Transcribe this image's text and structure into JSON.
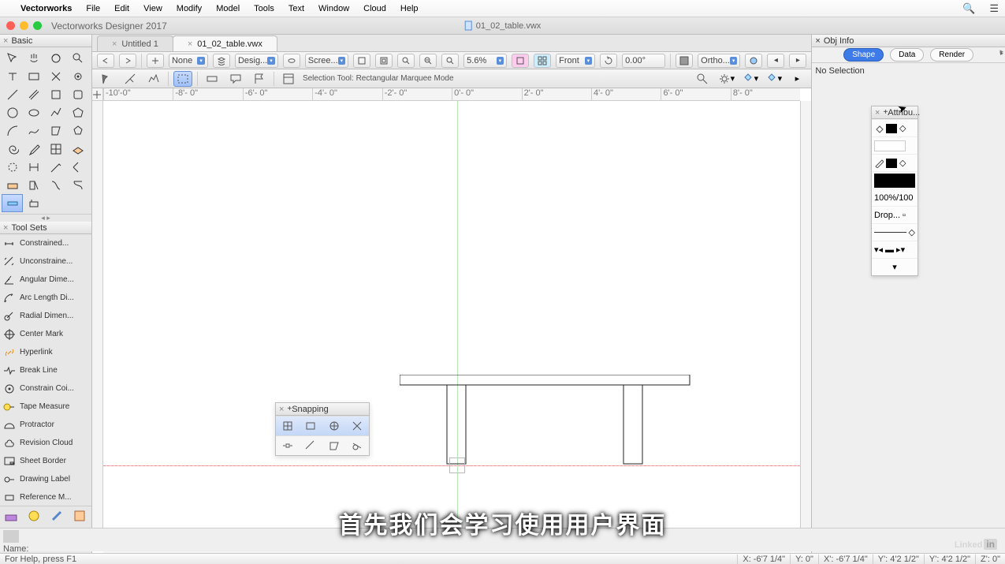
{
  "menubar": {
    "app": "Vectorworks",
    "items": [
      "File",
      "Edit",
      "View",
      "Modify",
      "Model",
      "Tools",
      "Text",
      "Window",
      "Cloud",
      "Help"
    ]
  },
  "titlebar": {
    "wintitle": "Vectorworks Designer 2017",
    "docfile": "01_02_table.vwx"
  },
  "doctabs": [
    {
      "label": "Untitled 1",
      "active": false
    },
    {
      "label": "01_02_table.vwx",
      "active": true
    }
  ],
  "basic": {
    "title": "Basic"
  },
  "toolsets": {
    "title": "Tool Sets",
    "items": [
      "Constrained...",
      "Unconstraine...",
      "Angular Dime...",
      "Arc Length Di...",
      "Radial Dimen...",
      "Center Mark",
      "Hyperlink",
      "Break Line",
      "Constrain Coi...",
      "Tape Measure",
      "Protractor",
      "Revision Cloud",
      "Sheet Border",
      "Drawing Label",
      "Reference M..."
    ]
  },
  "viewbar": {
    "none": "None",
    "design": "Desig...",
    "scree": "Scree...",
    "zoom": "5.6%",
    "front": "Front",
    "angle": "0.00°",
    "ortho": "Ortho..."
  },
  "modebar": {
    "text": "Selection Tool: Rectangular Marquee Mode"
  },
  "ruler_ticks": [
    "-10'-0\"",
    "-8'- 0\"",
    "-6'- 0\"",
    "-4'- 0\"",
    "-2'- 0\"",
    "0'- 0\"",
    "2'- 0\"",
    "4'- 0\"",
    "6'- 0\"",
    "8'- 0\""
  ],
  "snap": {
    "title": "Snapping"
  },
  "objinfo": {
    "title": "Obj Info",
    "tabs": [
      "Shape",
      "Data",
      "Render"
    ],
    "nosel": "No Selection",
    "name_label": "Name:"
  },
  "attrib": {
    "title": "Attribu...",
    "opacity": "100%/100",
    "drop": "Drop..."
  },
  "status": {
    "help": "For Help, press F1",
    "x": "X:   -6'7 1/4\"",
    "y": "Y:   0\"",
    "x2": "X':   -6'7 1/4\"",
    "y2": "Y':   4'2 1/2\"",
    "y3": "Y':   4'2 1/2\"",
    "z": "Z':   0\""
  },
  "subtitle": "首先我们会学习使用用户界面",
  "linkedin": "Linked"
}
